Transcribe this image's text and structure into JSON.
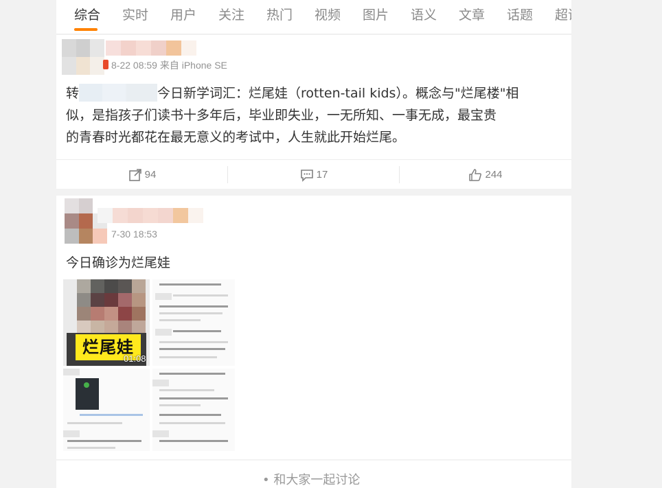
{
  "tabs": [
    "综合",
    "实时",
    "用户",
    "关注",
    "热门",
    "视频",
    "图片",
    "语义",
    "文章",
    "话题",
    "超话"
  ],
  "active_tab": "综合",
  "colors": {
    "accent": "#ff8200",
    "text_main": "#333333",
    "text_meta": "#939393",
    "background": "#f2f2f2"
  },
  "post1": {
    "meta": "8-22 08:59 来自 iPhone SE",
    "text_prefix": "转",
    "text_main": "今日新学词汇：烂尾娃（rotten-tail kids）。概念与\"烂尾楼\"相",
    "text_line2": "似，是指孩子们读书十多年后，毕业即失业，一无所知、一事无成，最宝贵",
    "text_line3": "的青春时光都花在最无意义的考试中，人生就此开始烂尾。",
    "actions": {
      "repost_count": "94",
      "comment_count": "17",
      "like_count": "244"
    }
  },
  "post2": {
    "meta": "7-30 18:53",
    "text": "今日确诊为烂尾娃",
    "video_caption": "烂尾娃",
    "video_duration": "01:08"
  },
  "post3": {
    "partial_text": "• 和大家一起讨论"
  },
  "icons": {
    "repost": "repost-icon",
    "comment": "comment-icon",
    "like": "thumbs-up-icon"
  }
}
